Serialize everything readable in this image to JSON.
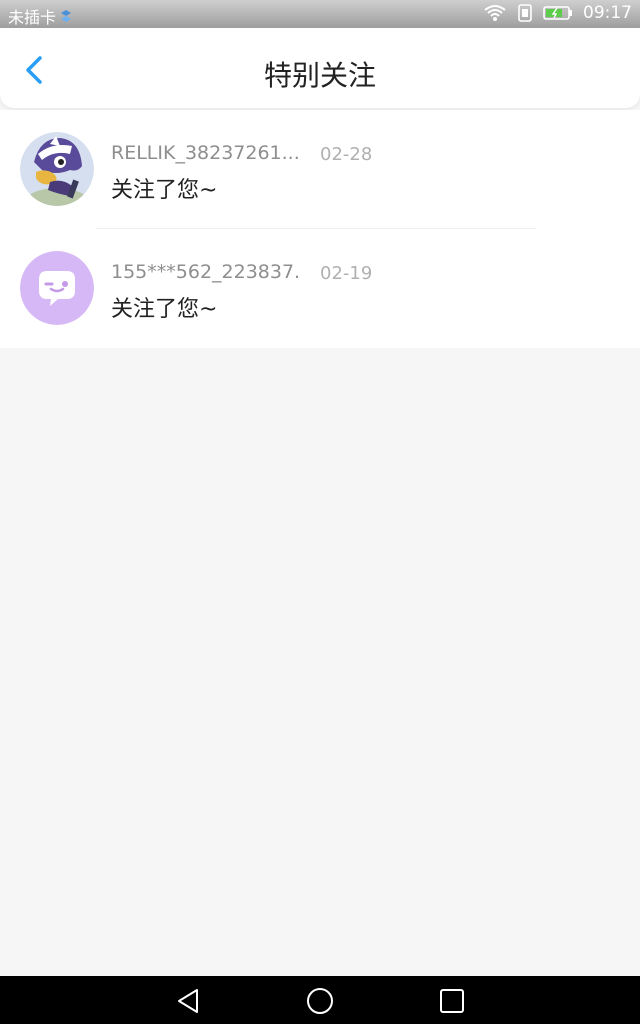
{
  "status_bar": {
    "carrier": "未插卡",
    "time": "09:17"
  },
  "header": {
    "title": "特别关注",
    "back_icon": "chevron-left-icon",
    "accent_color": "#2a9df4"
  },
  "list": {
    "items": [
      {
        "name": "RELLIK_38237261...",
        "date": "02-28",
        "message": "关注了您~",
        "avatar": "cartoon-avatar"
      },
      {
        "name": "155***562_223837...",
        "date": "02-19",
        "message": "关注了您~",
        "avatar": "chat-bubble-avatar"
      }
    ]
  },
  "nav_bar": {
    "icons": [
      "back-triangle-icon",
      "home-circle-icon",
      "recents-square-icon"
    ]
  }
}
